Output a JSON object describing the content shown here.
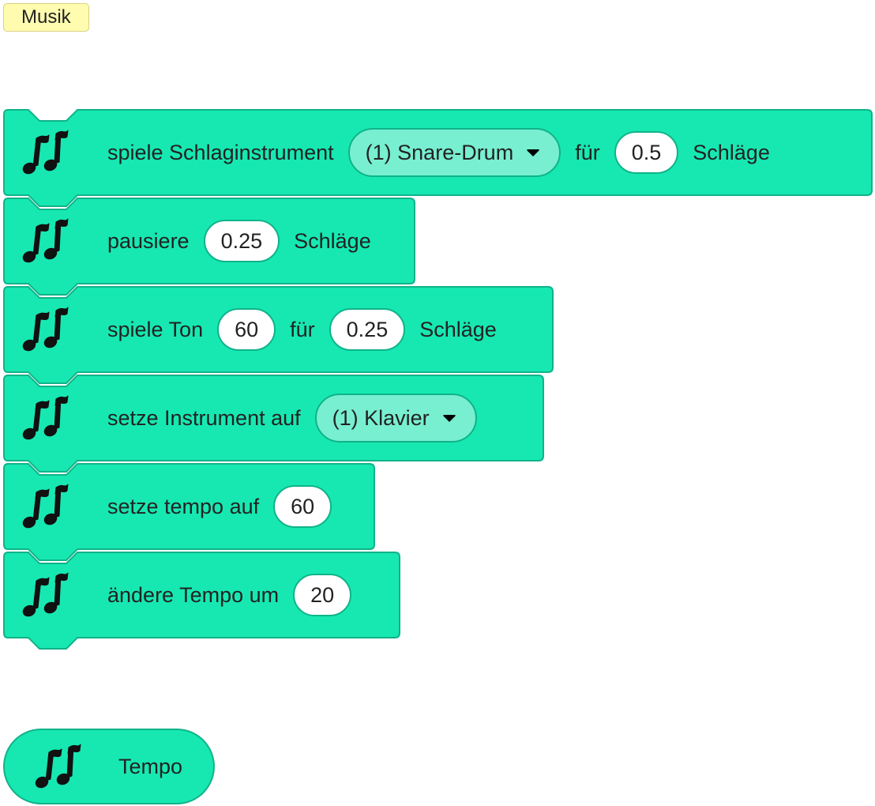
{
  "category_label": "Musik",
  "colors": {
    "block_fill": "#17e8b2",
    "block_stroke": "#0fb389",
    "dropdown_fill": "#78efd0"
  },
  "icon": "music-notes-icon",
  "blocks": [
    {
      "parts": [
        "spiele Schlaginstrument",
        "(1) Snare-Drum",
        "für",
        "0.5",
        "Schläge"
      ]
    },
    {
      "parts": [
        "pausiere",
        "0.25",
        "Schläge"
      ]
    },
    {
      "parts": [
        "spiele Ton",
        "60",
        "für",
        "0.25",
        "Schläge"
      ]
    },
    {
      "parts": [
        "setze Instrument auf",
        "(1) Klavier"
      ]
    },
    {
      "parts": [
        "setze tempo auf",
        "60"
      ]
    },
    {
      "parts": [
        "ändere Tempo um",
        "20"
      ]
    }
  ],
  "reporter": {
    "label": "Tempo"
  }
}
